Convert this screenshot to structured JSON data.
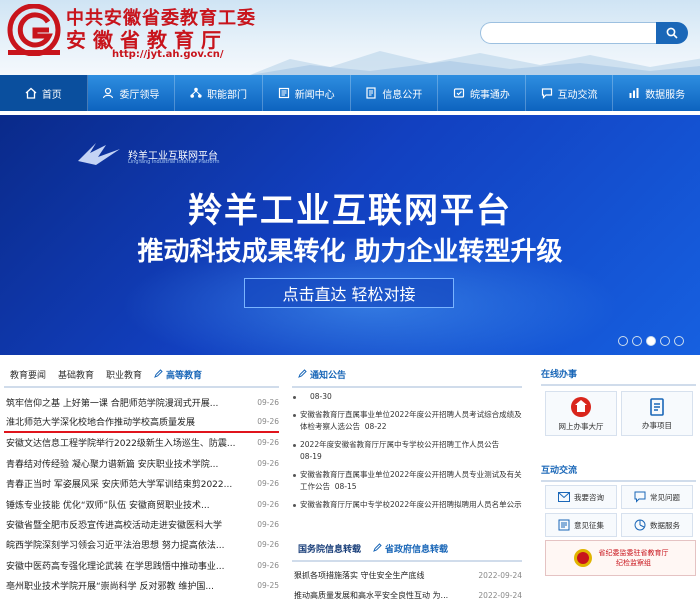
{
  "header": {
    "title_line1": "中共安徽省委教育工委",
    "title_line2": "安徽省教育厅",
    "url": "http://jyt.ah.gov.cn/",
    "search_placeholder": ""
  },
  "nav": {
    "items": [
      {
        "label": "首页",
        "icon": "home-icon"
      },
      {
        "label": "委厅领导",
        "icon": "user-icon"
      },
      {
        "label": "职能部门",
        "icon": "department-icon"
      },
      {
        "label": "新闻中心",
        "icon": "news-icon"
      },
      {
        "label": "信息公开",
        "icon": "info-icon"
      },
      {
        "label": "皖事通办",
        "icon": "service-icon"
      },
      {
        "label": "互动交流",
        "icon": "chat-icon"
      },
      {
        "label": "数据服务",
        "icon": "data-icon"
      }
    ]
  },
  "banner": {
    "brand": "羚羊工业互联网平台",
    "brand_en": "LingYang Industrial Internet Platform",
    "title": "羚羊工业互联网平台",
    "subtitle": "推动科技成果转化  助力企业转型升级",
    "button": "点击直达  轻松对接",
    "slides": 5,
    "active_slide": 3
  },
  "left_panel": {
    "tabs": [
      "教育要闻",
      "基础教育",
      "职业教育",
      "高等教育"
    ],
    "items": [
      {
        "title": "筑牢信仰之基 上好第一课 合肥师范学院漫润式开展...",
        "date": "09-26"
      },
      {
        "title": "淮北师范大学深化校地合作推动学校高质量发展",
        "date": "09-26"
      },
      {
        "title": "安徽文达信息工程学院举行2022级新生入场巡生、防震...",
        "date": "09-26"
      },
      {
        "title": "青春结对传经验 凝心聚力谱新篇 安庆职业技术学院...",
        "date": "09-26"
      },
      {
        "title": "青春正当时 军姿展风采 安庆师范大学军训结束剪2022...",
        "date": "09-26"
      },
      {
        "title": "锤炼专业技能 优化“双师”队伍 安徽商贸职业技术...",
        "date": "09-26"
      },
      {
        "title": "安徽省暨全肥市反恐宣传进高校活动走进安徽医科大学",
        "date": "09-26"
      },
      {
        "title": "皖西学院深刻学习领会习近平法治思想 努力提高依法...",
        "date": "09-26"
      },
      {
        "title": "安徽中医药高专强化理论武装 在学思践悟中推动事业...",
        "date": "09-26"
      },
      {
        "title": "亳州职业技术学院开展“崇尚科学 反对邪教 维护国...",
        "date": "09-25"
      }
    ]
  },
  "mid_panel": {
    "tab_notice": "通知公告",
    "notice_top_date": "08-30",
    "notices": [
      {
        "title": "安徽省教育厅直属事业单位2022年度公开招聘人员考试综合成绩及体检考察人选公告",
        "date": "08-22"
      },
      {
        "title": "2022年度安徽省教育厅厅属中专学校公开招聘工作人员公告",
        "date": "08-19"
      },
      {
        "title": "安徽省教育厅直属事业单位2022年度公开招聘人员专业测试及有关工作公告",
        "date": "08-15"
      },
      {
        "title": "安徽省教育厅厅属中专学校2022年度公开招聘拟聘用人员名单公示",
        "date": ""
      }
    ],
    "tabs2": [
      "国务院信息转载",
      "省政府信息转载"
    ],
    "items2": [
      {
        "title": "狠抓各项措施落实 守住安全生产底线",
        "date": "2022-09-24"
      },
      {
        "title": "推动高质量发展和高水平安全良性互动 为...",
        "date": "2022-09-24"
      }
    ]
  },
  "right_panel": {
    "online_title": "在线办事",
    "online_items": [
      {
        "label": "网上办事大厅",
        "icon": "hall-icon"
      },
      {
        "label": "办事项目",
        "icon": "doc-icon"
      }
    ],
    "interact_title": "互动交流",
    "interact_items": [
      {
        "label": "我要咨询",
        "icon": "mail-icon"
      },
      {
        "label": "常见问题",
        "icon": "question-icon"
      },
      {
        "label": "意见征集",
        "icon": "opinion-icon"
      },
      {
        "label": "数据服务",
        "icon": "chart-icon"
      }
    ],
    "jiwei_line1": "省纪委监委驻省教育厅",
    "jiwei_line2": "纪检监察组"
  },
  "colors": {
    "brand_red": "#c8141c",
    "nav_blue": "#0d63bf",
    "accent_blue": "#1a67b8"
  }
}
